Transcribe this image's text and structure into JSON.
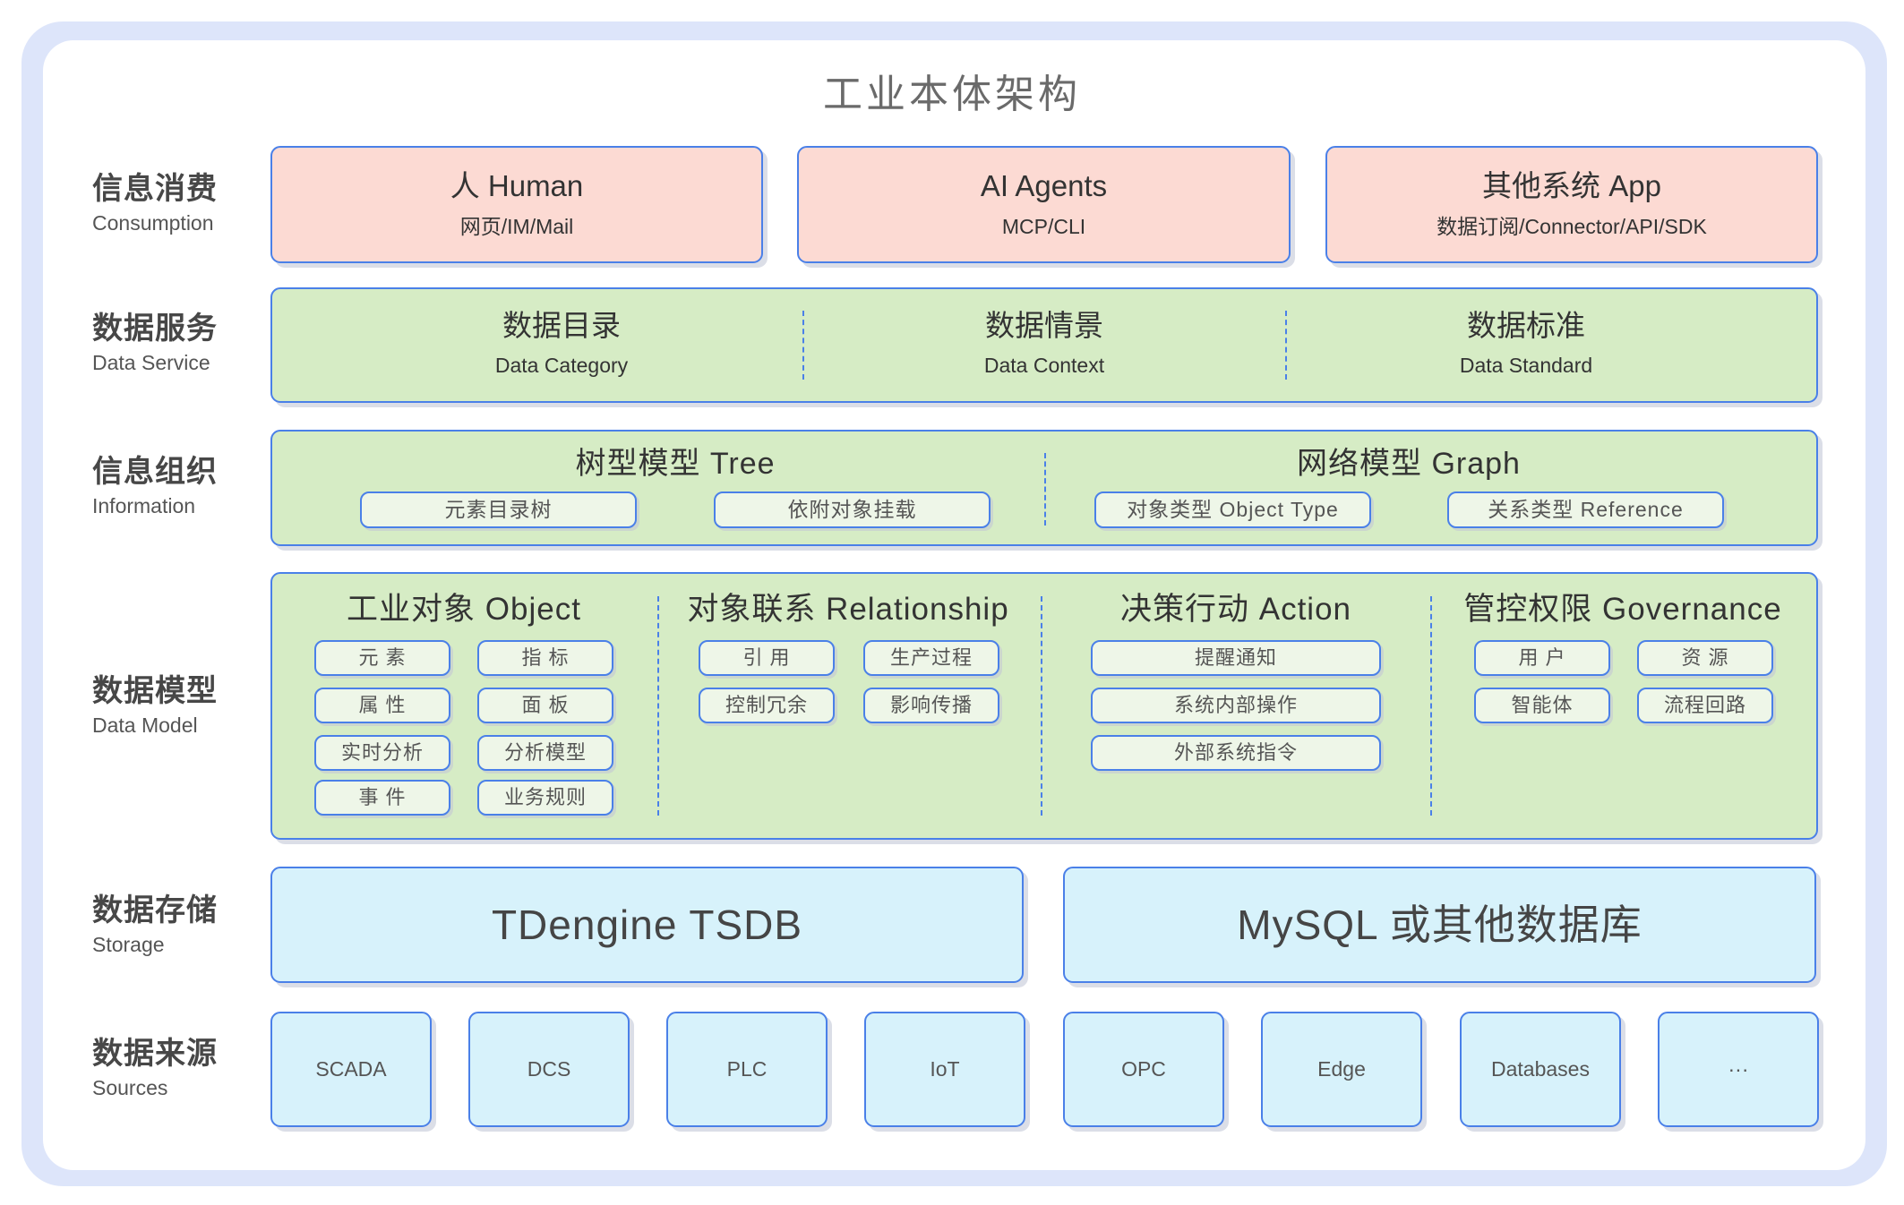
{
  "title": "工业本体架构",
  "colors": {
    "frame": "#dde5fa",
    "border": "#4a80e8",
    "consumption_fill": "#fcdad3",
    "green_fill": "#d6ecc5",
    "pill_fill": "#eef6e8",
    "storage_fill": "#d7f2fb"
  },
  "consumption": {
    "label_cn": "信息消费",
    "label_en": "Consumption",
    "items": [
      {
        "title": "人 Human",
        "subtitle": "网页/IM/Mail"
      },
      {
        "title": "AI Agents",
        "subtitle": "MCP/CLI"
      },
      {
        "title": "其他系统 App",
        "subtitle": "数据订阅/Connector/API/SDK"
      }
    ]
  },
  "data_service": {
    "label_cn": "数据服务",
    "label_en": "Data Service",
    "items": [
      {
        "title": "数据目录",
        "subtitle": "Data Category"
      },
      {
        "title": "数据情景",
        "subtitle": "Data Context"
      },
      {
        "title": "数据标准",
        "subtitle": "Data Standard"
      }
    ]
  },
  "information": {
    "label_cn": "信息组织",
    "label_en": "Information",
    "groups": [
      {
        "title": "树型模型 Tree",
        "items": [
          "元素目录树",
          "依附对象挂载"
        ]
      },
      {
        "title": "网络模型 Graph",
        "items": [
          "对象类型 Object Type",
          "关系类型 Reference"
        ]
      }
    ]
  },
  "data_model": {
    "label_cn": "数据模型",
    "label_en": "Data Model",
    "groups": [
      {
        "title": "工业对象 Object",
        "items": [
          "元 素",
          "指 标",
          "属 性",
          "面 板",
          "实时分析",
          "分析模型",
          "事 件",
          "业务规则"
        ]
      },
      {
        "title": "对象联系 Relationship",
        "items": [
          "引 用",
          "生产过程",
          "控制冗余",
          "影响传播"
        ]
      },
      {
        "title": "决策行动 Action",
        "items": [
          "提醒通知",
          "系统内部操作",
          "外部系统指令"
        ]
      },
      {
        "title": "管控权限 Governance",
        "items": [
          "用 户",
          "资 源",
          "智能体",
          "流程回路"
        ]
      }
    ]
  },
  "storage": {
    "label_cn": "数据存储",
    "label_en": "Storage",
    "items": [
      "TDengine TSDB",
      "MySQL 或其他数据库"
    ]
  },
  "sources": {
    "label_cn": "数据来源",
    "label_en": "Sources",
    "items": [
      "SCADA",
      "DCS",
      "PLC",
      "IoT",
      "OPC",
      "Edge",
      "Databases",
      "···"
    ]
  }
}
